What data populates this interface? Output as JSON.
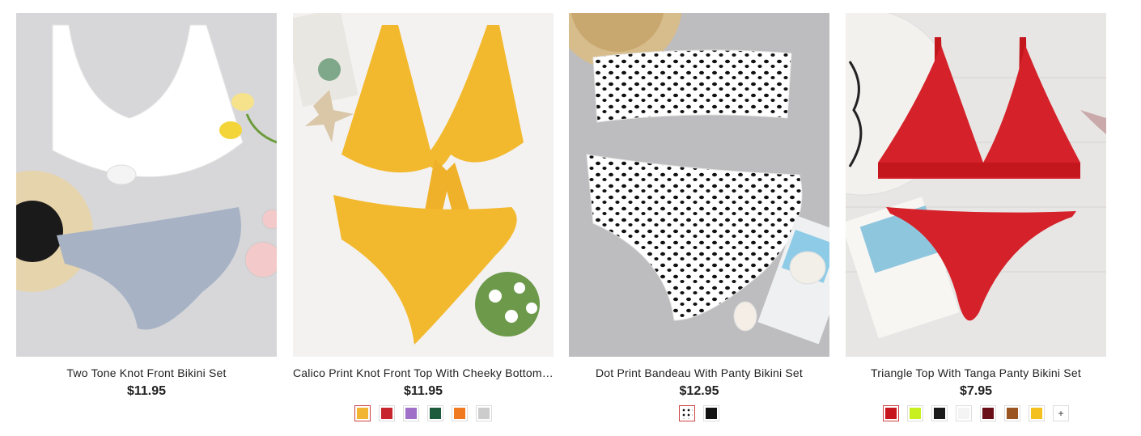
{
  "products": [
    {
      "title": "Two Tone Knot Front Bikini Set",
      "price": "$11.95",
      "swatches": []
    },
    {
      "title": "Calico Print Knot Front Top With Cheeky Bottom Bikini Set",
      "price": "$11.95",
      "swatches": [
        "#f2b533",
        "#c8262e",
        "#a070c8",
        "#1e5a3c",
        "#f07a20",
        "#cccccc"
      ]
    },
    {
      "title": "Dot Print Bandeau With Panty Bikini Set",
      "price": "$12.95",
      "swatches": [
        "#ffffff",
        "#111111"
      ]
    },
    {
      "title": "Triangle Top With Tanga Panty Bikini Set",
      "price": "$7.95",
      "swatches": [
        "#c8161e",
        "#c8f020",
        "#1a1a1a",
        "#f4f4f4",
        "#6a0f18",
        "#9a5522",
        "#f4c020"
      ],
      "more_label": "+"
    }
  ]
}
